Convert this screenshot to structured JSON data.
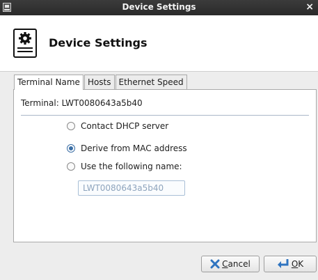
{
  "window": {
    "title": "Device Settings",
    "close_glyph": "×"
  },
  "header": {
    "title": "Device Settings",
    "icon": "device-settings-icon"
  },
  "tabs": [
    {
      "label": "Terminal Name",
      "active": true
    },
    {
      "label": "Hosts",
      "active": false
    },
    {
      "label": "Ethernet Speed",
      "active": false
    }
  ],
  "terminal": {
    "label": "Terminal:",
    "value": "LWT0080643a5b40"
  },
  "options": {
    "dhcp": {
      "label": "Contact DHCP server",
      "checked": false
    },
    "mac": {
      "label": "Derive from MAC address",
      "checked": true
    },
    "custom": {
      "label": "Use the following name:",
      "checked": false
    }
  },
  "name_field": {
    "value": "LWT0080643a5b40"
  },
  "buttons": {
    "cancel": {
      "mnemonic": "C",
      "rest": "ancel",
      "icon": "cancel-x-icon"
    },
    "ok": {
      "mnemonic": "O",
      "rest": "K",
      "icon": "ok-arrow-icon"
    }
  },
  "colors": {
    "accent": "#3b6ea5",
    "cancel_icon": "#2f74c0",
    "ok_icon": "#2f74c0"
  }
}
